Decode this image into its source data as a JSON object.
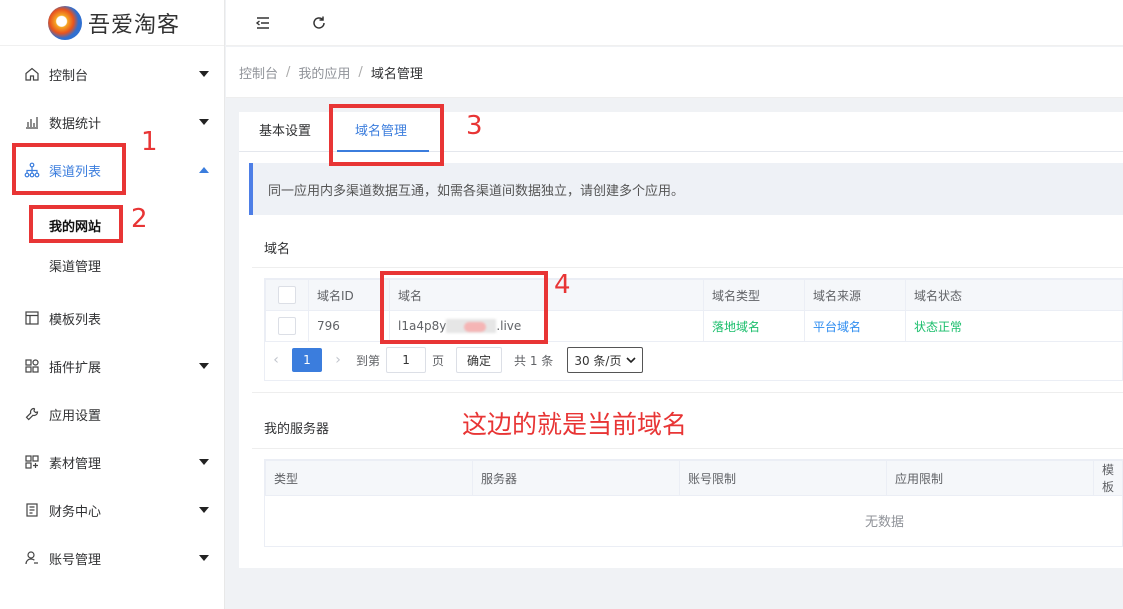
{
  "brand": {
    "name": "吾爱淘客"
  },
  "header": {
    "collapse_icon": "menu-fold-icon",
    "refresh_icon": "refresh-icon"
  },
  "breadcrumb": [
    "控制台",
    "我的应用",
    "域名管理"
  ],
  "sidebar": {
    "items": [
      {
        "label": "控制台",
        "icon": "home-icon"
      },
      {
        "label": "数据统计",
        "icon": "bar-chart-icon"
      },
      {
        "label": "渠道列表",
        "icon": "sitemap-icon"
      },
      {
        "label": "模板列表",
        "icon": "layout-icon"
      },
      {
        "label": "插件扩展",
        "icon": "apps-icon"
      },
      {
        "label": "应用设置",
        "icon": "wrench-icon"
      },
      {
        "label": "素材管理",
        "icon": "grid-icon"
      },
      {
        "label": "财务中心",
        "icon": "finance-icon"
      },
      {
        "label": "账号管理",
        "icon": "user-icon"
      }
    ],
    "sub_items": [
      {
        "label": "我的网站"
      },
      {
        "label": "渠道管理"
      }
    ]
  },
  "tabs": [
    {
      "label": "基本设置"
    },
    {
      "label": "域名管理"
    }
  ],
  "alert": "同一应用内多渠道数据互通，如需各渠道间数据独立，请创建多个应用。",
  "domain_section": {
    "title": "域名",
    "columns": [
      "域名ID",
      "域名",
      "域名类型",
      "域名来源",
      "域名状态"
    ],
    "rows": [
      {
        "id": "796",
        "domain_prefix": "l1a4p8y",
        "domain_suffix": ".live",
        "type": "落地域名",
        "source": "平台域名",
        "status": "状态正常"
      }
    ]
  },
  "pager": {
    "current": "1",
    "goto_label": "到第",
    "goto_value": "1",
    "page_unit": "页",
    "confirm": "确定",
    "total": "共 1 条",
    "page_size": "30 条/页"
  },
  "server_section": {
    "title": "我的服务器",
    "columns": [
      "类型",
      "服务器",
      "账号限制",
      "应用限制",
      "模板"
    ],
    "empty": "无数据"
  },
  "annotations": {
    "n1": "1",
    "n2": "2",
    "n3": "3",
    "n4": "4",
    "note": "这边的就是当前域名"
  },
  "colors": {
    "accent": "#3b7ddd",
    "annotation": "#e83535",
    "success": "#19be6b"
  }
}
